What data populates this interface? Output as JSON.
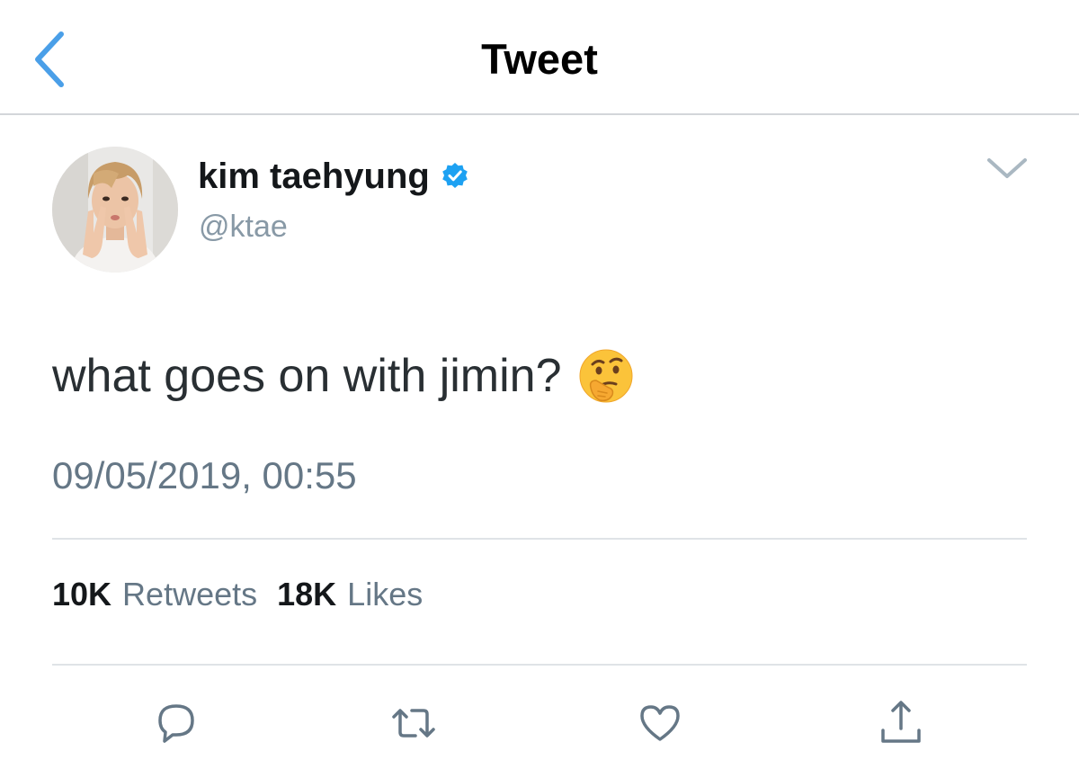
{
  "nav": {
    "title": "Tweet",
    "back_icon": "chevron-left-icon"
  },
  "author": {
    "display_name": "kim taehyung",
    "handle": "@ktae",
    "verified": true,
    "verified_icon": "verified-badge-icon"
  },
  "tweet": {
    "text": "what goes on with jimin?",
    "emoji": "thinking-face-emoji",
    "timestamp": "09/05/2019, 00:55"
  },
  "stats": {
    "retweets_count": "10K",
    "retweets_label": "Retweets",
    "likes_count": "18K",
    "likes_label": "Likes"
  },
  "actions": [
    {
      "icon": "reply-icon"
    },
    {
      "icon": "retweet-icon"
    },
    {
      "icon": "like-icon"
    },
    {
      "icon": "share-icon"
    }
  ],
  "colors": {
    "accent": "#4a9fe8",
    "verified": "#1da1f2",
    "secondary_text": "#657786",
    "icon": "#657786",
    "divider": "#dfe3e7"
  }
}
